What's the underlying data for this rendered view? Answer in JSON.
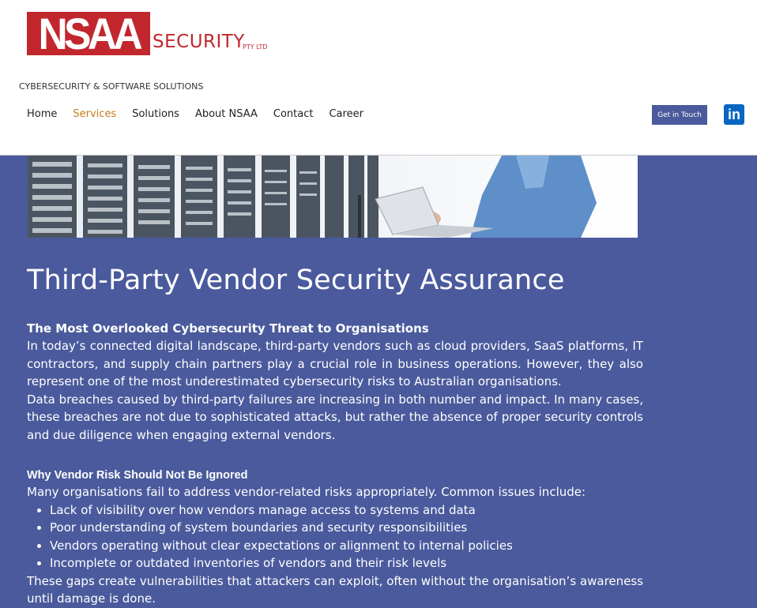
{
  "header": {
    "logo_mark": "NSAA",
    "logo_word": "SECURITY",
    "logo_sub": "PTY LTD",
    "tagline": "CYBERSECURITY & SOFTWARE SOLUTIONS",
    "nav": [
      "Home",
      "Services",
      "Solutions",
      "About NSAA",
      "Contact",
      "Career"
    ],
    "active_nav": "Services",
    "cta_label": "Get in Touch",
    "social_icon": "linkedin-icon",
    "social_glyph": "in"
  },
  "colors": {
    "brand_red": "#c1272d",
    "page_background": "#4a5a9c",
    "nav_active": "#c77a1a",
    "linkedin": "#0a66c2"
  },
  "main": {
    "title": "Third-Party Vendor Security Assurance",
    "section1_heading": "The Most Overlooked Cybersecurity Threat to Organisations",
    "section1_p1": "In today’s connected digital landscape, third-party vendors such as cloud providers, SaaS platforms, IT contractors, and supply chain partners play a crucial role in business operations. However, they also represent one of the most underestimated cybersecurity risks to Australian organisations.",
    "section1_p2": "Data breaches caused by third-party failures are increasing in both number and impact. In many cases, these breaches are not due to sophisticated attacks, but rather the absence of proper security controls and due diligence when engaging external vendors.",
    "section2_heading": "Why Vendor Risk Should Not Be Ignored",
    "section2_intro": "Many organisations fail to address vendor-related risks appropriately. Common issues include:",
    "issues": [
      "Lack of visibility over how vendors manage access to systems and data",
      "Poor understanding of system boundaries and security responsibilities",
      "Vendors operating without clear expectations or alignment to internal policies",
      "Incomplete or outdated inventories of vendors and their risk levels"
    ],
    "section2_outro": "These gaps create vulnerabilities that attackers can exploit, often without the organisation’s awareness until damage is done."
  }
}
